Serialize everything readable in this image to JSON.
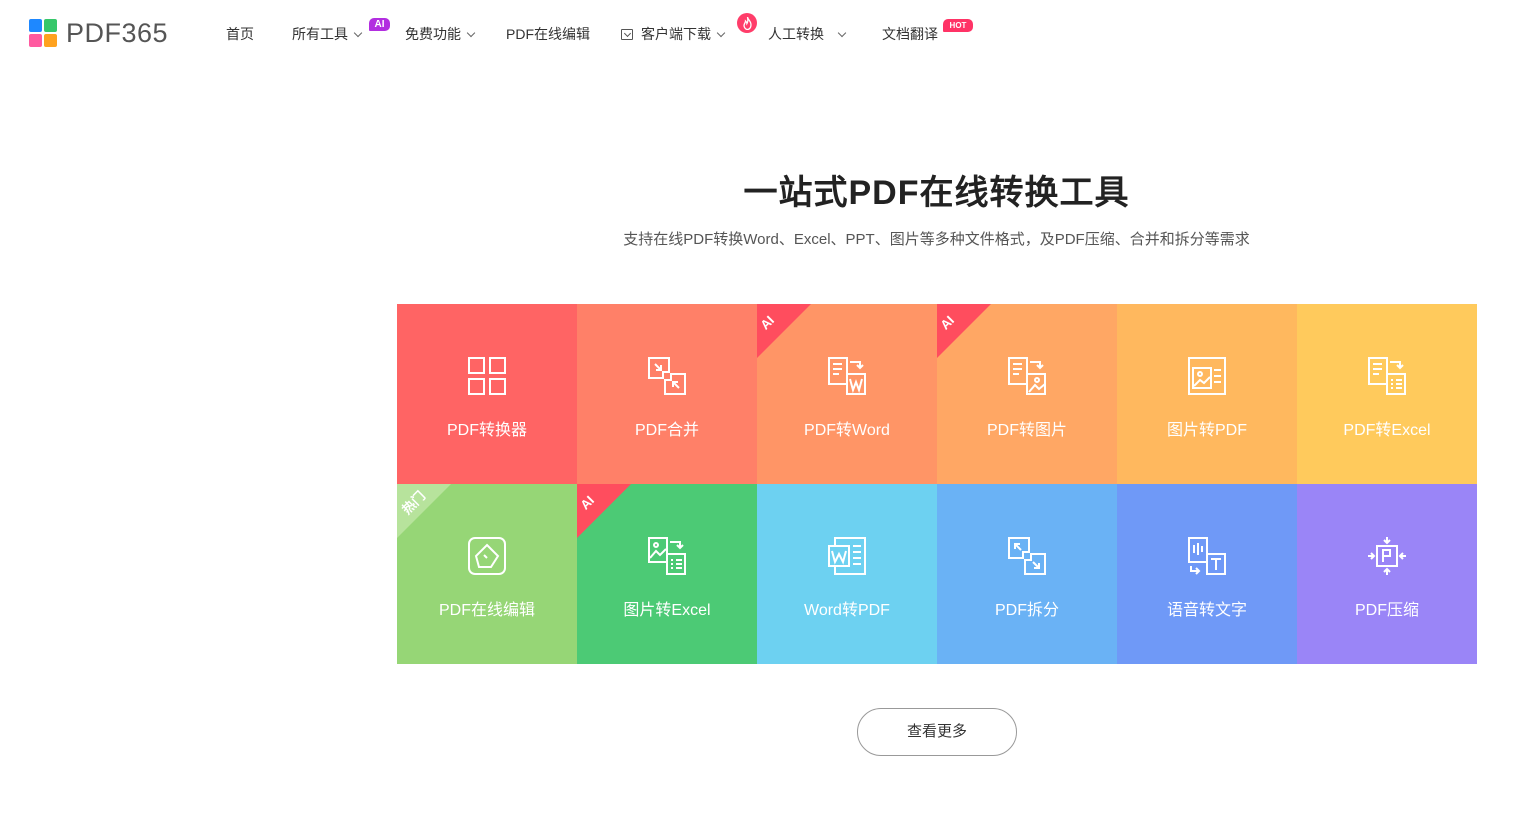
{
  "brand": {
    "logo_text": "PDF365",
    "logo_colors": [
      "#1e88ff",
      "#36c76a",
      "#ff5aa0",
      "#ffa21f"
    ]
  },
  "nav": {
    "items": [
      {
        "label": "首页"
      },
      {
        "label": "所有工具",
        "dropdown": true,
        "badge": "AI"
      },
      {
        "label": "免费功能",
        "dropdown": true
      },
      {
        "label": "PDF在线编辑"
      },
      {
        "label": "客户端下载",
        "dropdown": true,
        "icon": "download-icon"
      },
      {
        "label": "人工转换",
        "dropdown": true,
        "icon": "fire-icon"
      },
      {
        "label": "文档翻译",
        "badge": "HOT"
      }
    ]
  },
  "hero": {
    "title": "一站式PDF在线转换工具",
    "subtitle": "支持在线PDF转换Word、Excel、PPT、图片等多种文件格式，及PDF压缩、合并和拆分等需求"
  },
  "tools": [
    {
      "label": "PDF转换器",
      "color": "#ff6464",
      "icon": "grid-icon"
    },
    {
      "label": "PDF合并",
      "color": "#ff8068",
      "icon": "merge-icon"
    },
    {
      "label": "PDF转Word",
      "color": "#ff9566",
      "icon": "pdf-to-word-icon",
      "corner": "AI",
      "corner_color": "#ff4d5e"
    },
    {
      "label": "PDF转图片",
      "color": "#ffa764",
      "icon": "pdf-to-image-icon",
      "corner": "AI",
      "corner_color": "#ff4d5e"
    },
    {
      "label": "图片转PDF",
      "color": "#ffb85e",
      "icon": "image-to-pdf-icon"
    },
    {
      "label": "PDF转Excel",
      "color": "#ffca5c",
      "icon": "pdf-to-excel-icon"
    },
    {
      "label": "PDF在线编辑",
      "color": "#96d676",
      "icon": "edit-icon",
      "corner": "热门",
      "corner_color": "#b7e39c"
    },
    {
      "label": "图片转Excel",
      "color": "#4cca75",
      "icon": "image-to-excel-icon",
      "corner": "AI",
      "corner_color": "#ff4d5e"
    },
    {
      "label": "Word转PDF",
      "color": "#6dd1f1",
      "icon": "word-to-pdf-icon"
    },
    {
      "label": "PDF拆分",
      "color": "#6ab2f5",
      "icon": "split-icon"
    },
    {
      "label": "语音转文字",
      "color": "#6f99f7",
      "icon": "speech-to-text-icon"
    },
    {
      "label": "PDF压缩",
      "color": "#9a85f7",
      "icon": "compress-icon"
    }
  ],
  "more_button": "查看更多"
}
